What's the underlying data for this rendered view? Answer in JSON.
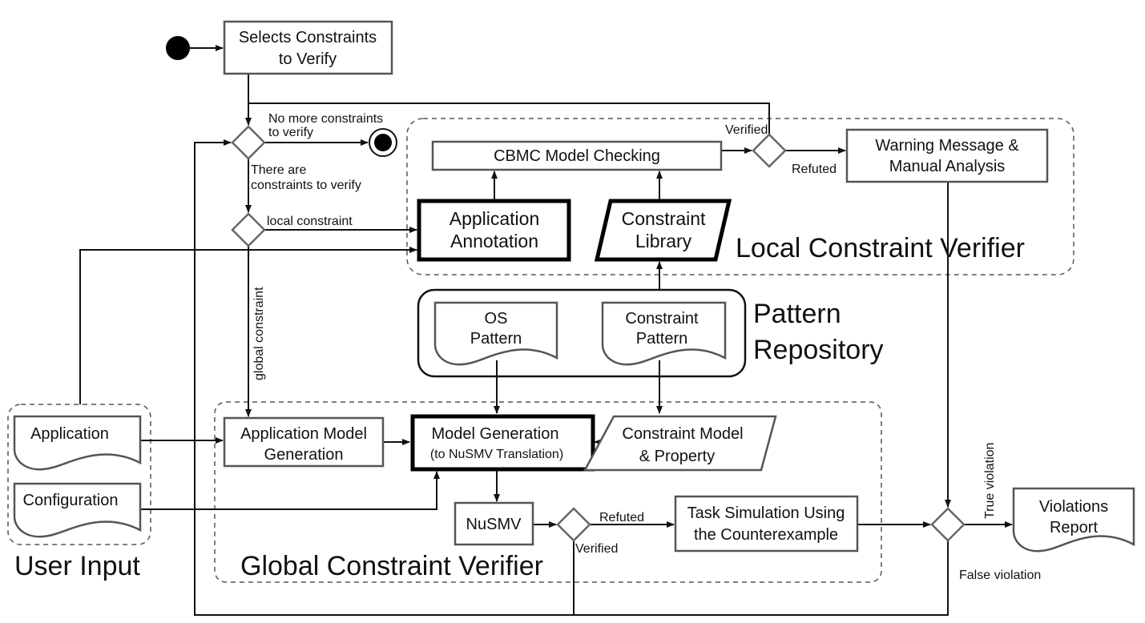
{
  "nodes": {
    "select": [
      "Selects Constraints",
      "to Verify"
    ],
    "cbmc": "CBMC Model Checking",
    "app_annotation": [
      "Application",
      "Annotation"
    ],
    "constraint_library": [
      "Constraint",
      "Library"
    ],
    "warning": [
      "Warning Message &",
      "Manual Analysis"
    ],
    "os_pattern": [
      "OS",
      "Pattern"
    ],
    "constraint_pattern": [
      "Constraint",
      "Pattern"
    ],
    "application": "Application",
    "configuration": "Configuration",
    "app_model_gen": [
      "Application Model",
      "Generation"
    ],
    "model_gen": [
      "Model Generation",
      "(to NuSMV Translation)"
    ],
    "constraint_model": [
      "Constraint Model",
      "& Property"
    ],
    "nusmv": "NuSMV",
    "task_sim": [
      "Task Simulation Using",
      "the Counterexample"
    ],
    "violations": [
      "Violations",
      "Report"
    ]
  },
  "edges": {
    "no_more": [
      "No more constraints",
      "to verify"
    ],
    "there_are": [
      "There are",
      "constraints to verify"
    ],
    "local": "local constraint",
    "global": "global constraint",
    "verified_top": "Verified",
    "refuted_top": "Refuted",
    "refuted_bottom": "Refuted",
    "verified_bottom": "Verified",
    "true_violation": "True violation",
    "false_violation": "False violation"
  },
  "groups": {
    "local_verifier": "Local Constraint Verifier",
    "pattern_repo": [
      "Pattern",
      "Repository"
    ],
    "global_verifier": "Global Constraint Verifier",
    "user_input": "User Input"
  }
}
